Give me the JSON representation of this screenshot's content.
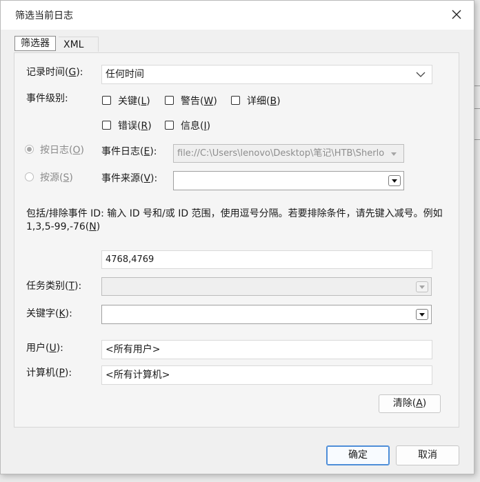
{
  "dialog": {
    "title": "筛选当前日志"
  },
  "tabs": [
    {
      "label": "筛选器"
    },
    {
      "label": "XML"
    }
  ],
  "logged": {
    "label": "记录时间(",
    "key": "G",
    "end": "):",
    "value": "任何时间"
  },
  "event_level": {
    "label": "事件级别:",
    "options": [
      {
        "label": "关键(",
        "key": "L",
        "end": ")"
      },
      {
        "label": "警告(",
        "key": "W",
        "end": ")"
      },
      {
        "label": "详细(",
        "key": "B",
        "end": ")"
      },
      {
        "label": "错误(",
        "key": "R",
        "end": ")"
      },
      {
        "label": "信息(",
        "key": "I",
        "end": ")"
      }
    ]
  },
  "by_log": {
    "label": "按日志(",
    "key": "O",
    "end": ")"
  },
  "by_source": {
    "label": "按源(",
    "key": "S",
    "end": ")"
  },
  "event_logs": {
    "label": "事件日志(",
    "key": "E",
    "end": "):",
    "value": "file://C:\\Users\\lenovo\\Desktop\\笔记\\HTB\\Sherlo"
  },
  "event_sources": {
    "label": "事件来源(",
    "key": "V",
    "end": "):",
    "value": ""
  },
  "id_hint": {
    "text": "包括/排除事件 ID: 输入 ID 号和/或 ID 范围，使用逗号分隔。若要排除条件，请先键入减号。例如 1,3,5-99,-76(",
    "key": "N",
    "end": ")"
  },
  "event_ids": {
    "value": "4768,4769"
  },
  "task_category": {
    "label": "任务类别(",
    "key": "T",
    "end": "):",
    "value": ""
  },
  "keywords": {
    "label": "关键字(",
    "key": "K",
    "end": "):",
    "value": ""
  },
  "user": {
    "label": "用户(",
    "key": "U",
    "end": "):",
    "value": "<所有用户>"
  },
  "computer": {
    "label": "计算机(",
    "key": "P",
    "end": "):",
    "value": "<所有计算机>"
  },
  "clear_button": {
    "label": "清除(",
    "key": "A",
    "end": ")"
  },
  "ok_button": {
    "label": "确定"
  },
  "cancel_button": {
    "label": "取消"
  }
}
